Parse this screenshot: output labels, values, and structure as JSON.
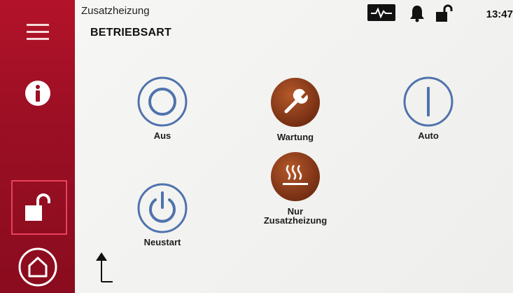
{
  "header": {
    "title": "Zusatzheizung",
    "subtitle": "BETRIEBSART",
    "time": "13:47"
  },
  "sidebar": {
    "items": [
      {
        "name": "menu",
        "icon": "hamburger-menu-icon"
      },
      {
        "name": "info",
        "icon": "info-icon"
      },
      {
        "name": "lock",
        "icon": "unlock-icon",
        "highlighted": true
      },
      {
        "name": "home",
        "icon": "home-icon"
      }
    ]
  },
  "status_icons": [
    "pulse-icon",
    "bell-icon",
    "unlock-icon"
  ],
  "modes": {
    "aus": {
      "label": "Aus",
      "icon": "off-circle-icon"
    },
    "wartung": {
      "label": "Wartung",
      "icon": "wrench-icon",
      "active": true
    },
    "auto": {
      "label": "Auto",
      "icon": "on-line-icon"
    },
    "neustart": {
      "label": "Neustart",
      "icon": "power-icon"
    },
    "nur_zusatzheizung": {
      "label_line1": "Nur",
      "label_line2": "Zusatzheizung",
      "icon": "heater-icon",
      "active": true
    }
  },
  "colors": {
    "sidebar": "#9c0f24",
    "highlight": "#e8425a",
    "active_mode": "#8a3a18",
    "mode_outline": "#4f73ad"
  }
}
